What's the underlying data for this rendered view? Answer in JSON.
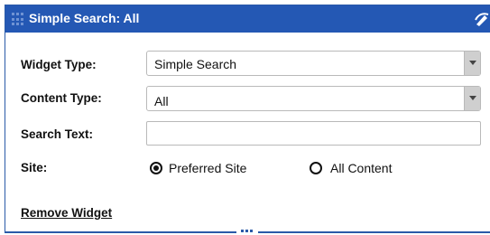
{
  "window": {
    "title": "Simple Search: All",
    "grip_icon": "drag-grid-icon",
    "titlebar_icon": "edit-icon"
  },
  "form": {
    "widget_type": {
      "label": "Widget Type:",
      "value": "Simple Search"
    },
    "content_type": {
      "label": "Content Type:",
      "value": "All"
    },
    "search_text": {
      "label": "Search Text:",
      "value": "",
      "placeholder": ""
    },
    "site": {
      "label": "Site:",
      "options": [
        {
          "label": "Preferred Site",
          "selected": true
        },
        {
          "label": "All Content",
          "selected": false
        }
      ]
    }
  },
  "actions": {
    "remove_widget": "Remove Widget"
  },
  "colors": {
    "titlebar": "#2458b4",
    "border": "#2a5aa8"
  }
}
